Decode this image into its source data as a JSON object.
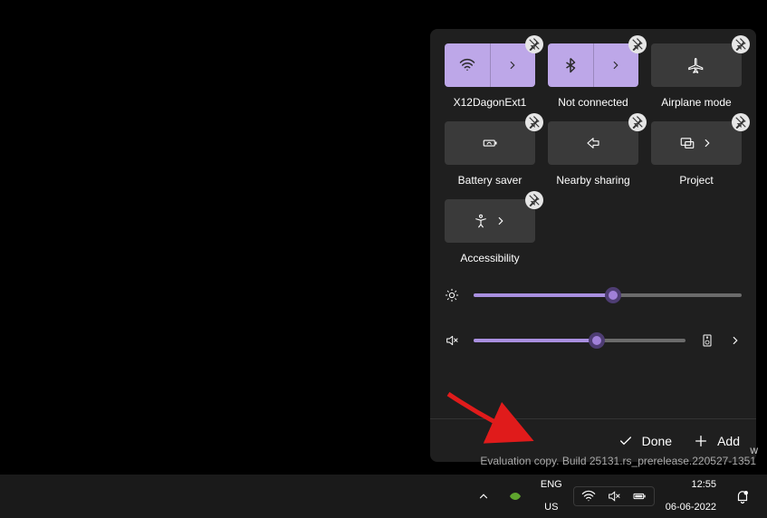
{
  "panel": {
    "tiles": [
      {
        "id": "wifi",
        "label": "X12DagonExt1",
        "active": true,
        "split": true
      },
      {
        "id": "bluetooth",
        "label": "Not connected",
        "active": true,
        "split": true
      },
      {
        "id": "airplane",
        "label": "Airplane mode",
        "active": false,
        "split": false
      },
      {
        "id": "battery-saver",
        "label": "Battery saver",
        "active": false,
        "split": false
      },
      {
        "id": "nearby-sharing",
        "label": "Nearby sharing",
        "active": false,
        "split": false
      },
      {
        "id": "project",
        "label": "Project",
        "active": false,
        "split": true
      },
      {
        "id": "accessibility",
        "label": "Accessibility",
        "active": false,
        "split": true
      }
    ],
    "sliders": {
      "brightness": {
        "percent": 52
      },
      "volume": {
        "percent": 58,
        "muted": true
      }
    },
    "footer": {
      "done_label": "Done",
      "add_label": "Add"
    }
  },
  "watermark": "Evaluation copy. Build 25131.rs_prerelease.220527-1351",
  "taskbar": {
    "lang_top": "ENG",
    "lang_bottom": "US",
    "time": "12:55",
    "date": "06-06-2022"
  }
}
